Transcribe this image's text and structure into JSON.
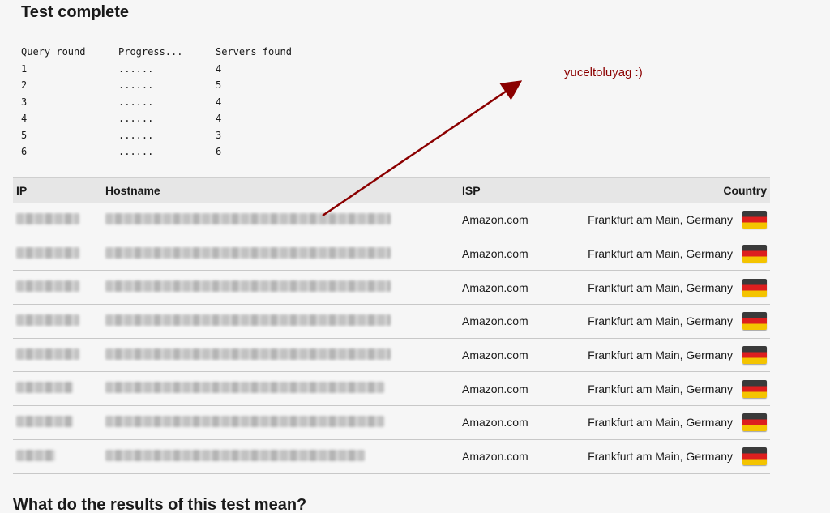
{
  "title": "Test complete",
  "query": {
    "headers": [
      "Query round",
      "Progress...",
      "Servers found"
    ],
    "rows": [
      [
        "1",
        "......",
        "4"
      ],
      [
        "2",
        "......",
        "5"
      ],
      [
        "3",
        "......",
        "4"
      ],
      [
        "4",
        "......",
        "4"
      ],
      [
        "5",
        "......",
        "3"
      ],
      [
        "6",
        "......",
        "6"
      ]
    ]
  },
  "annotation": {
    "text": "yuceltoluyag :)",
    "color": "#8b0000"
  },
  "results": {
    "headers": {
      "ip": "IP",
      "hostname": "Hostname",
      "isp": "ISP",
      "country": "Country"
    },
    "rows": [
      {
        "isp": "Amazon.com",
        "country": "Frankfurt am Main, Germany",
        "flag": "germany-flag-icon"
      },
      {
        "isp": "Amazon.com",
        "country": "Frankfurt am Main, Germany",
        "flag": "germany-flag-icon"
      },
      {
        "isp": "Amazon.com",
        "country": "Frankfurt am Main, Germany",
        "flag": "germany-flag-icon"
      },
      {
        "isp": "Amazon.com",
        "country": "Frankfurt am Main, Germany",
        "flag": "germany-flag-icon"
      },
      {
        "isp": "Amazon.com",
        "country": "Frankfurt am Main, Germany",
        "flag": "germany-flag-icon"
      },
      {
        "isp": "Amazon.com",
        "country": "Frankfurt am Main, Germany",
        "flag": "germany-flag-icon"
      },
      {
        "isp": "Amazon.com",
        "country": "Frankfurt am Main, Germany",
        "flag": "germany-flag-icon"
      },
      {
        "isp": "Amazon.com",
        "country": "Frankfurt am Main, Germany",
        "flag": "germany-flag-icon"
      }
    ]
  },
  "section_heading": "What do the results of this test mean?"
}
